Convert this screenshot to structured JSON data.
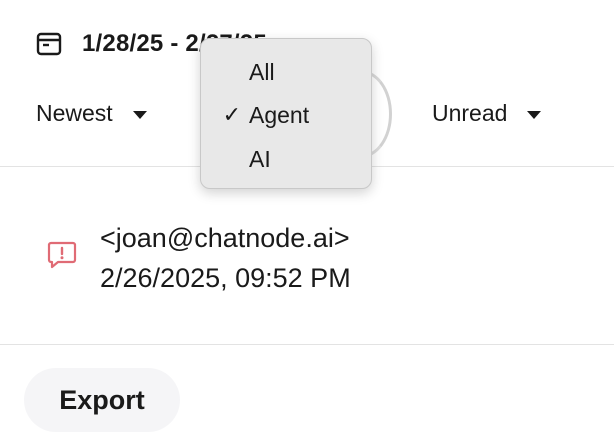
{
  "date_range": {
    "icon": "calendar-icon",
    "text": "1/28/25 - 2/27/25"
  },
  "filters": {
    "sort": {
      "label": "Newest",
      "icon": "caret-down-icon"
    },
    "read": {
      "label": "Unread",
      "icon": "caret-down-icon"
    }
  },
  "type_menu": {
    "items": [
      {
        "label": "All",
        "checked": false
      },
      {
        "label": "Agent",
        "checked": true,
        "check_mark": "✓"
      },
      {
        "label": "AI",
        "checked": false
      }
    ]
  },
  "message": {
    "icon": "alert-message-icon",
    "sender": "<joan@chatnode.ai>",
    "timestamp": "2/26/2025, 09:52 PM"
  },
  "actions": {
    "export_label": "Export"
  },
  "colors": {
    "alert": "#e06b75",
    "menu_bg": "#e8e8e8",
    "divider": "#e3e3e3",
    "button_bg": "#f5f5f7"
  }
}
